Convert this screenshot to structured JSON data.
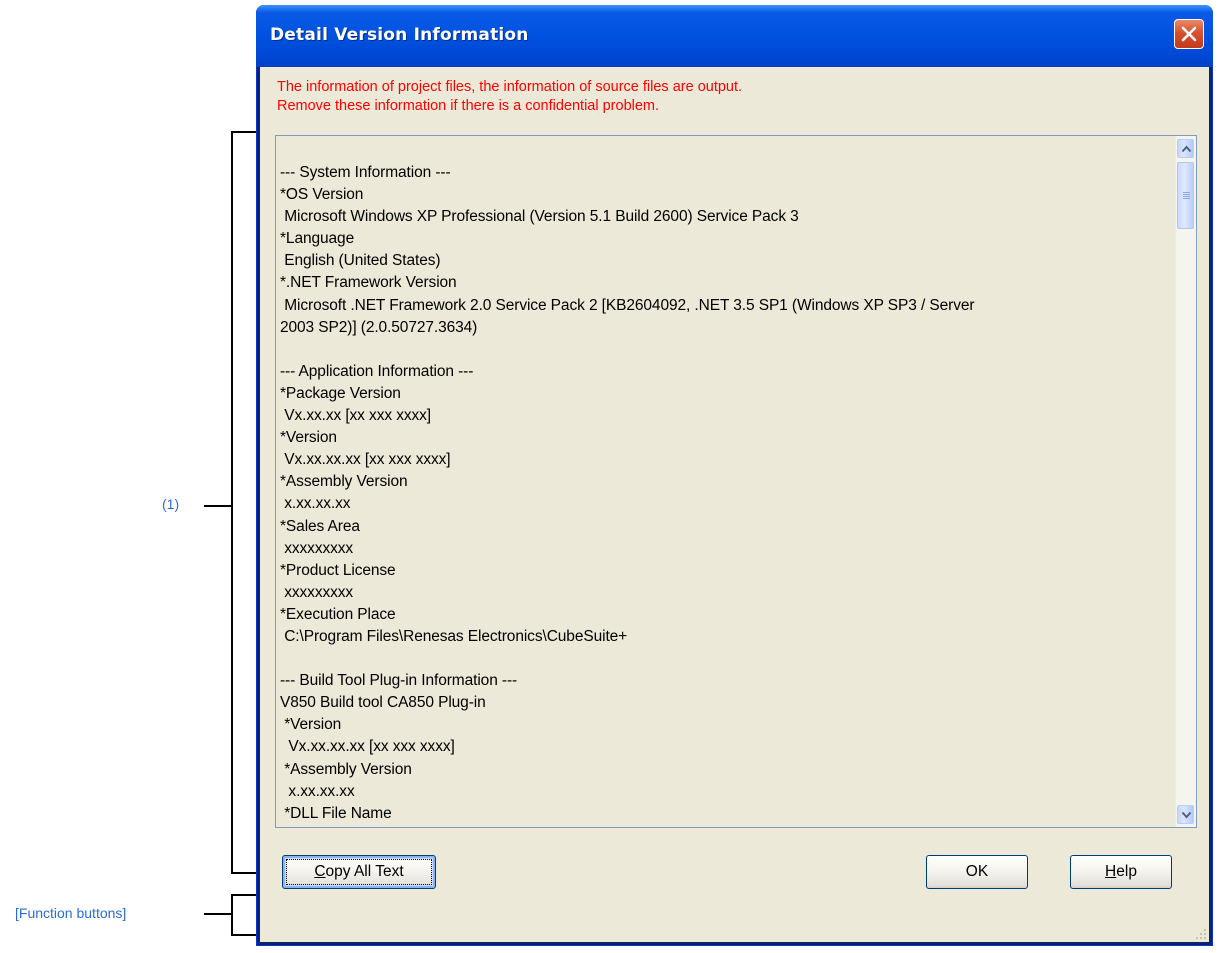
{
  "annotations": {
    "area_label": "(1)",
    "buttons_label": "[Function buttons]"
  },
  "dialog": {
    "title": "Detail Version Information",
    "warning_lines": [
      "The information of project files, the information of source files are output.",
      "Remove these information if there is a confidential problem."
    ],
    "text_lines": [
      "--- System Information ---",
      "*OS Version",
      " Microsoft Windows XP Professional (Version 5.1 Build 2600) Service Pack 3",
      "*Language",
      " English (United States)",
      "*.NET Framework Version",
      " Microsoft .NET Framework 2.0 Service Pack 2 [KB2604092, .NET 3.5 SP1 (Windows XP SP3 / Server",
      "2003 SP2)] (2.0.50727.3634)",
      "",
      "--- Application Information ---",
      "*Package Version",
      " Vx.xx.xx [xx xxx xxxx]",
      "*Version",
      " Vx.xx.xx.xx [xx xxx xxxx]",
      "*Assembly Version",
      " x.xx.xx.xx",
      "*Sales Area",
      " xxxxxxxxx",
      "*Product License",
      " xxxxxxxxx",
      "*Execution Place",
      " C:\\Program Files\\Renesas Electronics\\CubeSuite+",
      "",
      "--- Build Tool Plug-in Information ---",
      "V850 Build tool CA850 Plug-in",
      " *Version",
      "  Vx.xx.xx.xx [xx xxx xxxx]",
      " *Assembly Version",
      "  x.xx.xx.xx",
      " *DLL File Name"
    ],
    "buttons": {
      "copy_all_text": "Copy All Text",
      "ok": "OK",
      "help": "Help"
    },
    "icons": {
      "close": "close-icon",
      "scroll_up": "scroll-up-arrow-icon",
      "scroll_down": "scroll-down-arrow-icon",
      "resize": "resize-grip-icon"
    },
    "colors": {
      "title_bar": "#0054e3",
      "client_bg": "#ece9d8",
      "warning_text": "#ff0000",
      "annotation_text": "#2b6cd6",
      "close_button": "#d8502e"
    }
  }
}
